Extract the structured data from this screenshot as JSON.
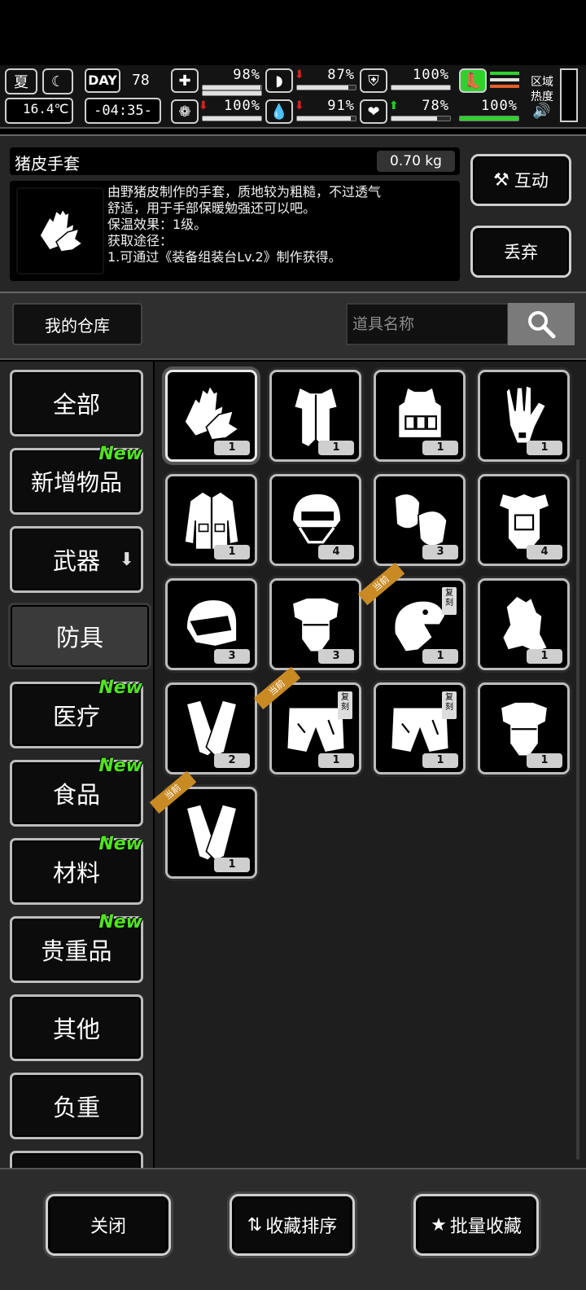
{
  "status": {
    "season": "夏",
    "temperature": "16.4℃",
    "day_label": "DAY",
    "day_number": "78",
    "clock": "-04:35-",
    "health_pct": "98%",
    "health_level": 0.98,
    "stomach_pct": "87%",
    "stomach_level": 0.87,
    "armor_pct": "100%",
    "armor_level": 1.0,
    "stamina_pct": "100%",
    "stamina_level": 1.0,
    "brain_pct": "100%",
    "brain_level": 1.0,
    "thirst_pct": "91%",
    "thirst_level": 0.91,
    "mood_pct": "78%",
    "mood_level": 0.78,
    "zone_heat_label_1": "区域",
    "zone_heat_label_2": "热度",
    "colors": {
      "stamina_green": "#2fd12f",
      "alert_red": "#e21c1c",
      "up_green": "#20d020",
      "heat_orange": "#e0602a"
    }
  },
  "detail": {
    "name": "猪皮手套",
    "weight": "0.70 kg",
    "description": "由野猪皮制作的手套，质地较为粗糙，不过透气\n舒适，用于手部保暖勉强还可以吧。\n保温效果：1级。\n获取途径：\n1.可通过《装备组装台Lv.2》制作获得。",
    "interact_label": "互动",
    "discard_label": "丢弃"
  },
  "warehouse": {
    "tab_label": "我的仓库",
    "search_placeholder": "道具名称"
  },
  "categories": [
    {
      "label": "全部",
      "new": ""
    },
    {
      "label": "新增物品",
      "new": "New"
    },
    {
      "label": "武器",
      "new": ""
    },
    {
      "label": "防具",
      "new": ""
    },
    {
      "label": "医疗",
      "new": "New"
    },
    {
      "label": "食品",
      "new": "New"
    },
    {
      "label": "材料",
      "new": "New"
    },
    {
      "label": "贵重品",
      "new": "New"
    },
    {
      "label": "其他",
      "new": ""
    },
    {
      "label": "负重",
      "new": ""
    }
  ],
  "items": [
    {
      "icon": "pigskin-gloves-icon",
      "qty": "1",
      "ribbon": "",
      "tag": ""
    },
    {
      "icon": "fur-vest-icon",
      "qty": "1",
      "ribbon": "",
      "tag": ""
    },
    {
      "icon": "tactical-vest-icon",
      "qty": "1",
      "ribbon": "",
      "tag": ""
    },
    {
      "icon": "glove-icon",
      "qty": "1",
      "ribbon": "",
      "tag": ""
    },
    {
      "icon": "jacket-icon",
      "qty": "1",
      "ribbon": "",
      "tag": ""
    },
    {
      "icon": "tactical-helmet-icon",
      "qty": "4",
      "ribbon": "",
      "tag": ""
    },
    {
      "icon": "knee-pads-icon",
      "qty": "3",
      "ribbon": "",
      "tag": ""
    },
    {
      "icon": "body-armor-icon",
      "qty": "4",
      "ribbon": "",
      "tag": ""
    },
    {
      "icon": "motorcycle-helmet-icon",
      "qty": "3",
      "ribbon": "",
      "tag": ""
    },
    {
      "icon": "chest-plate-icon",
      "qty": "3",
      "ribbon": "",
      "tag": ""
    },
    {
      "icon": "dino-head-icon",
      "qty": "1",
      "ribbon": "当前",
      "tag": "复刻"
    },
    {
      "icon": "fur-wrap-icon",
      "qty": "1",
      "ribbon": "",
      "tag": ""
    },
    {
      "icon": "shin-guards-icon",
      "qty": "2",
      "ribbon": "",
      "tag": ""
    },
    {
      "icon": "shorts-icon",
      "qty": "1",
      "ribbon": "当前",
      "tag": "复刻"
    },
    {
      "icon": "shorts-icon",
      "qty": "1",
      "ribbon": "",
      "tag": "复刻"
    },
    {
      "icon": "chest-plate-icon",
      "qty": "1",
      "ribbon": "",
      "tag": ""
    },
    {
      "icon": "shin-guards-icon",
      "qty": "1",
      "ribbon": "当前",
      "tag": ""
    }
  ],
  "bottom": {
    "close_label": "关闭",
    "sort_label": "收藏排序",
    "batch_label": "批量收藏"
  }
}
